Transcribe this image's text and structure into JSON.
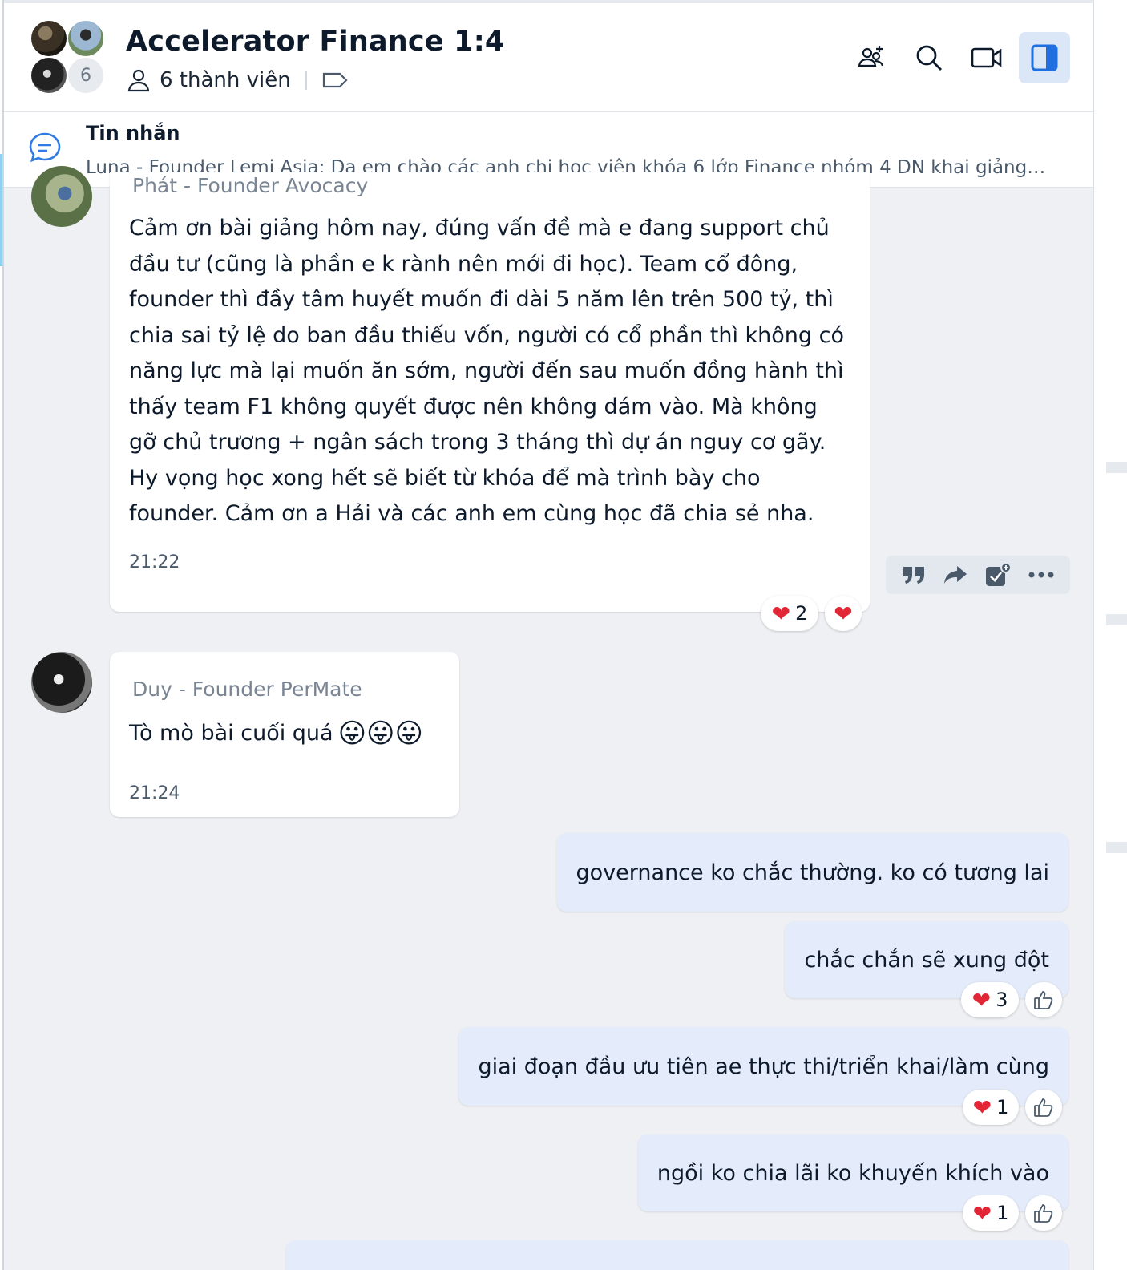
{
  "header": {
    "title": "Accelerator Finance 1:4",
    "member_count_badge": "6",
    "members_label": "6 thành viên",
    "icons": [
      "add-member-icon",
      "search-icon",
      "video-call-icon",
      "side-panel-icon"
    ]
  },
  "pinned": {
    "title": "Tin nhắn",
    "text": "Luna - Founder Lemi Asia: Dạ em chào các anh chị học viên khóa 6 lớp Finance nhóm 4 DN khai giảng ngày ..."
  },
  "messages": [
    {
      "sender": "Phát - Founder Avocacy",
      "text": "Cảm ơn bài giảng hôm nay, đúng vấn đề mà e đang support chủ đầu tư (cũng là phần e k rành nên mới đi học).  Team cổ đông, founder thì đầy tâm huyết muốn đi dài 5 năm lên trên 500 tỷ, thì chia sai tỷ lệ do ban đầu thiếu vốn, người có cổ phần thì không có năng lực mà lại muốn ăn sớm, người đến sau muốn đồng hành thì thấy team F1 không quyết được nên không dám vào. Mà không gỡ chủ trương + ngân sách trong 3 tháng thì dự án nguy cơ gãy. Hy vọng học xong hết sẽ biết từ khóa để mà trình bày cho founder. Cảm ơn a Hải và các anh em cùng học đã chia sẻ nha.",
      "time": "21:22",
      "reaction_count": "2"
    },
    {
      "sender": "Duy - Founder PerMate",
      "text": "Tò mò bài cuối quá",
      "emoji": "😛😛😛",
      "time": "21:24"
    }
  ],
  "outgoing": [
    {
      "text": "governance ko chắc thường. ko có tương lai"
    },
    {
      "text": "chắc chắn sẽ xung đột",
      "reaction_count": "3"
    },
    {
      "text": "giai đoạn đầu ưu tiên ae thực thi/triển khai/làm cùng",
      "reaction_count": "1"
    },
    {
      "text": "ngồi ko chia lãi ko khuyến khích vào",
      "reaction_count": "1"
    }
  ],
  "colors": {
    "accent": "#2f7be5",
    "outgoing_bubble": "#e4ebfa",
    "heart": "#e32636"
  }
}
